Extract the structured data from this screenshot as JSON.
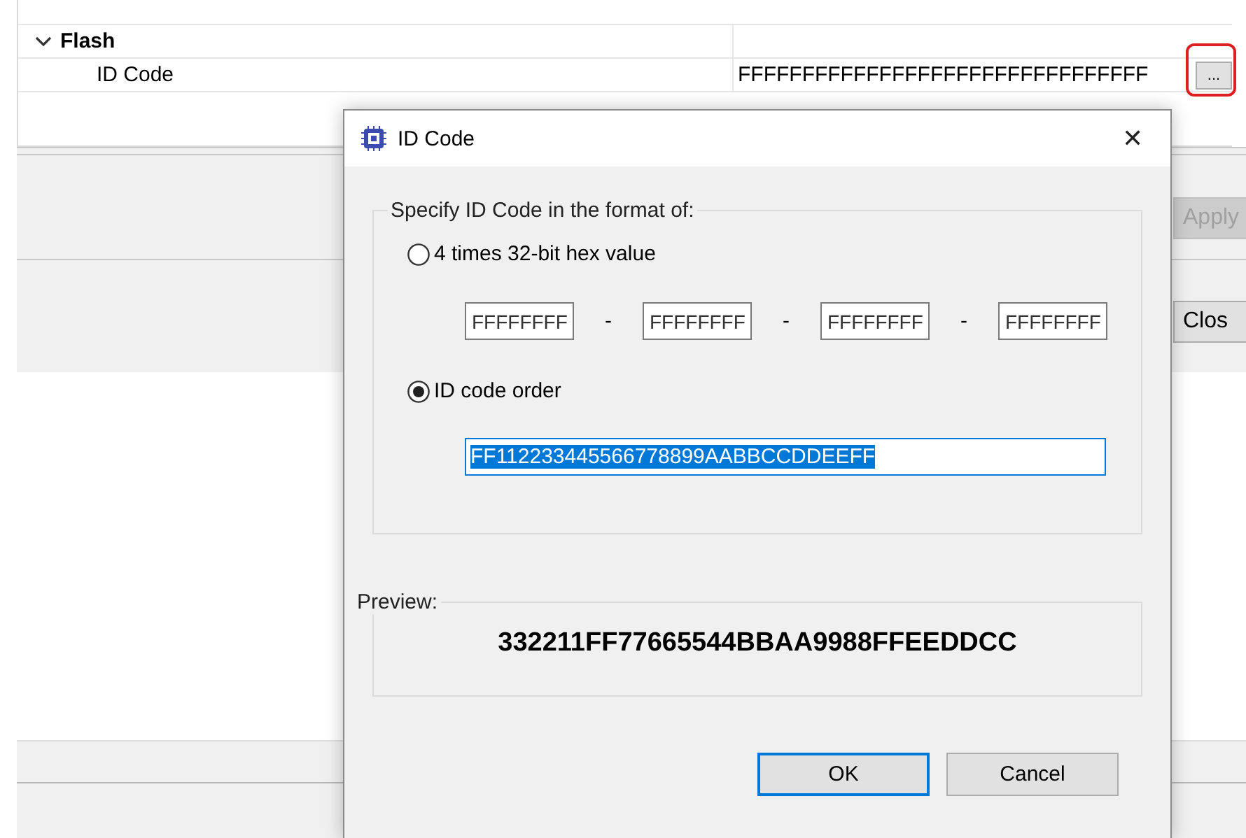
{
  "properties": {
    "rows": [
      {
        "label": "Flash",
        "expanded": true,
        "children": [
          {
            "label": "ID Code",
            "value": "FFFFFFFFFFFFFFFFFFFFFFFFFFFFFFFF",
            "button": "...",
            "highlighted": true
          }
        ]
      }
    ]
  },
  "side_buttons": [
    {
      "label": "Apply",
      "disabled": true
    },
    {
      "label": "Clos",
      "disabled": false
    }
  ],
  "dialog": {
    "title": "ID Code",
    "close": "✕",
    "format_group": {
      "legend": "Specify ID Code in the format of:",
      "options": [
        {
          "kind": "split",
          "label": "4 times 32-bit hex value",
          "selected": false,
          "fields": [
            "FFFFFFFF",
            "FFFFFFFF",
            "FFFFFFFF",
            "FFFFFFFF"
          ],
          "separators": [
            "-",
            "-",
            "-"
          ]
        },
        {
          "kind": "single",
          "label": "ID code order",
          "selected": true,
          "value": "FF112233445566778899AABBCCDDEEFF",
          "text_selected": true
        }
      ]
    },
    "preview": {
      "legend": "Preview:",
      "value": "332211FF77665544BBAA9988FFEEDDCC"
    },
    "buttons": [
      {
        "label": "OK",
        "default": true
      },
      {
        "label": "Cancel",
        "default": false
      }
    ]
  }
}
